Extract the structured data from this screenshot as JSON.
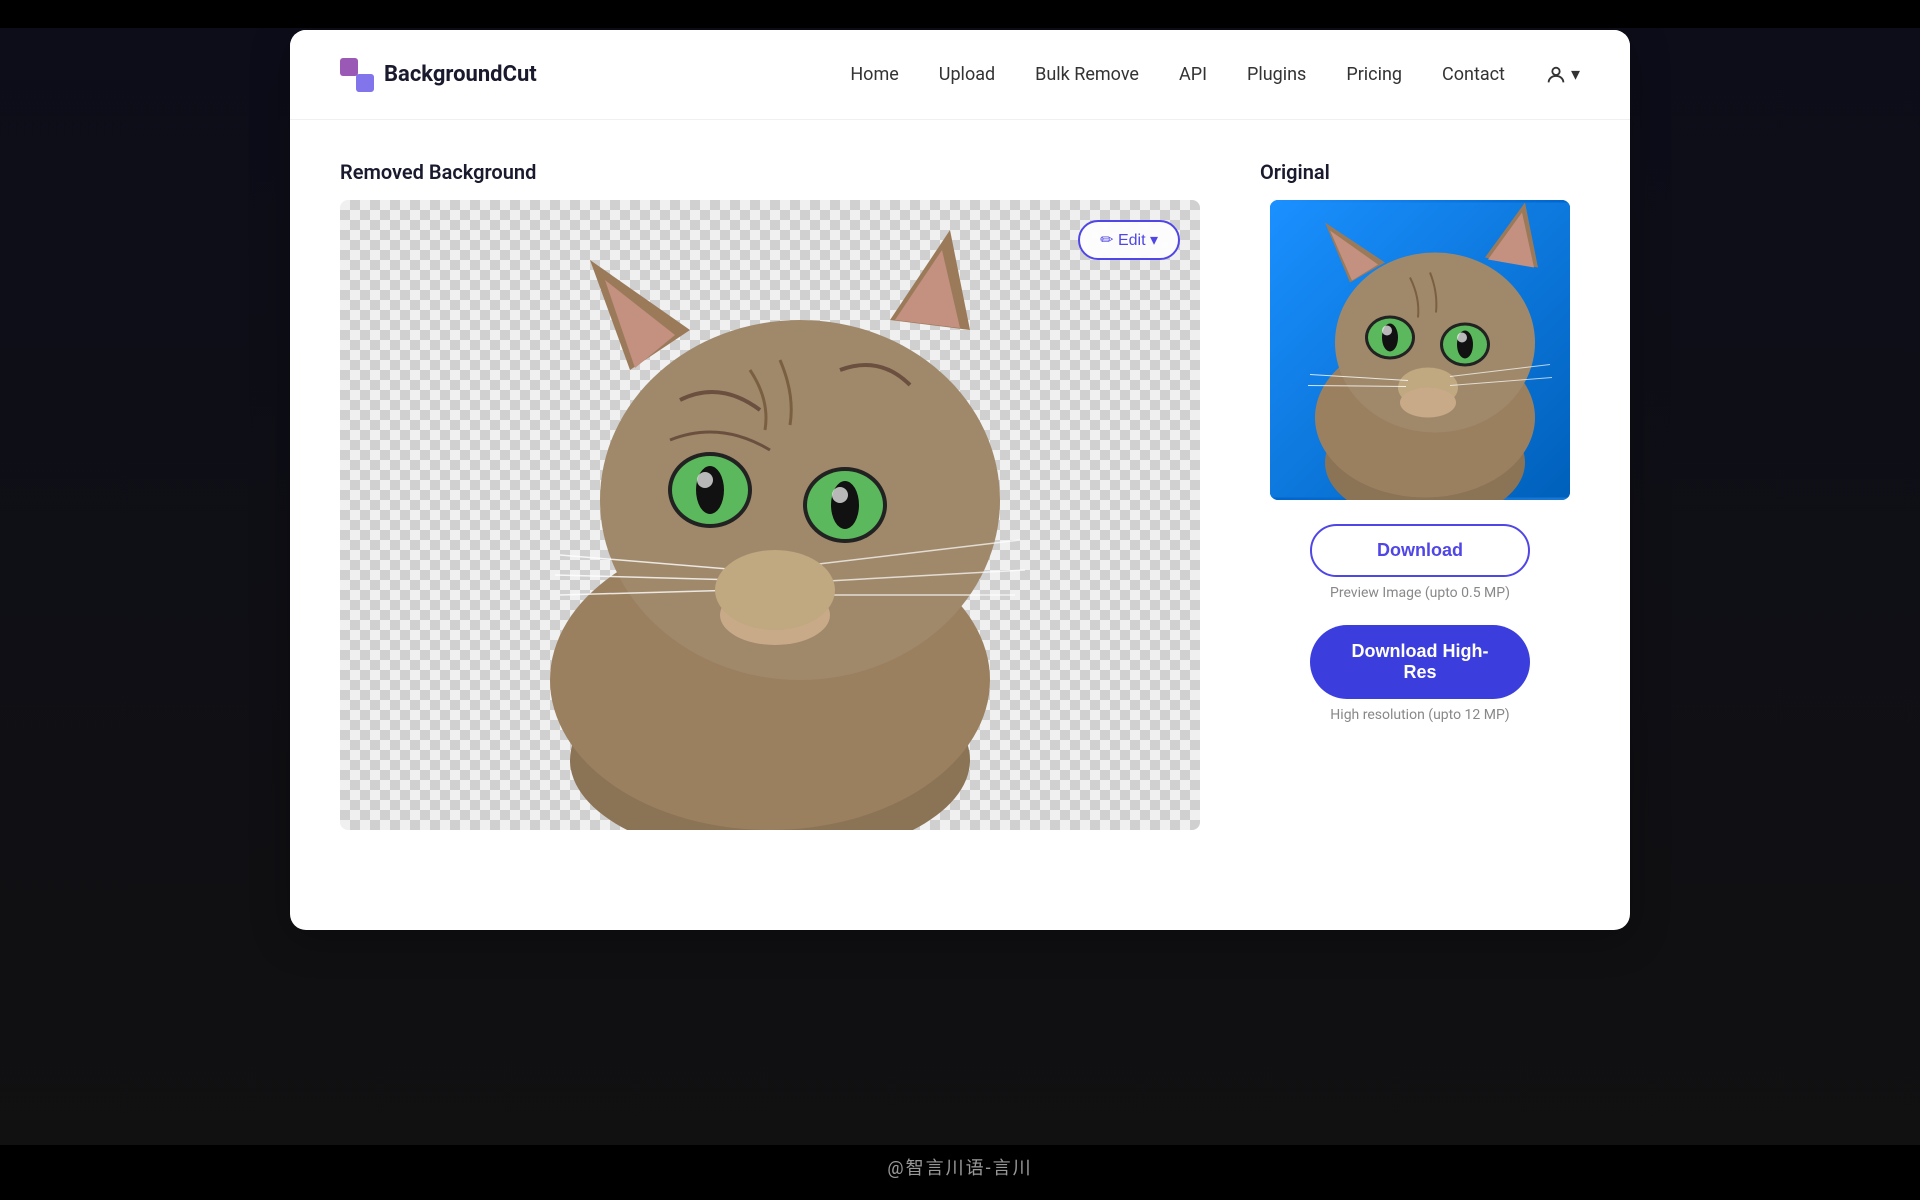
{
  "nav": {
    "logo_text": "BackgroundCut",
    "links": [
      "Home",
      "Upload",
      "Bulk Remove",
      "API",
      "Plugins",
      "Pricing",
      "Contact"
    ]
  },
  "left_panel": {
    "title": "Removed Background",
    "edit_button": "✏ Edit ▾"
  },
  "right_panel": {
    "title": "Original",
    "download_btn": "Download",
    "preview_text": "Preview Image (upto 0.5 MP)",
    "download_hires_btn": "Download High-Res",
    "hires_text": "High resolution (upto 12 MP)"
  },
  "watermark": "@智言川语-言川"
}
